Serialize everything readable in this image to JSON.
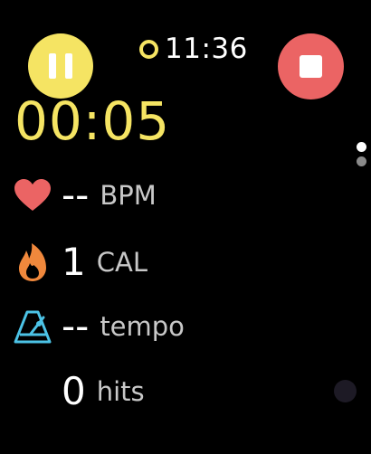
{
  "status_bar": {
    "time": "11:36"
  },
  "workout": {
    "elapsed": "00:05"
  },
  "controls": {
    "pause_icon": "pause-icon",
    "stop_icon": "stop-icon",
    "pause_color": "#f5e463",
    "stop_color": "#eb6464"
  },
  "pagination": {
    "pages": 2,
    "current": 1
  },
  "metrics": {
    "heart": {
      "icon": "heart-icon",
      "value": "--",
      "unit": "BPM",
      "color": "#eb6464"
    },
    "calories": {
      "icon": "flame-icon",
      "value": "1",
      "unit": "CAL",
      "color": "#f0883c"
    },
    "tempo": {
      "icon": "metronome-icon",
      "value": "--",
      "unit": "tempo",
      "color": "#4cc3e6"
    },
    "hits": {
      "value": "0",
      "unit": "hits"
    }
  }
}
